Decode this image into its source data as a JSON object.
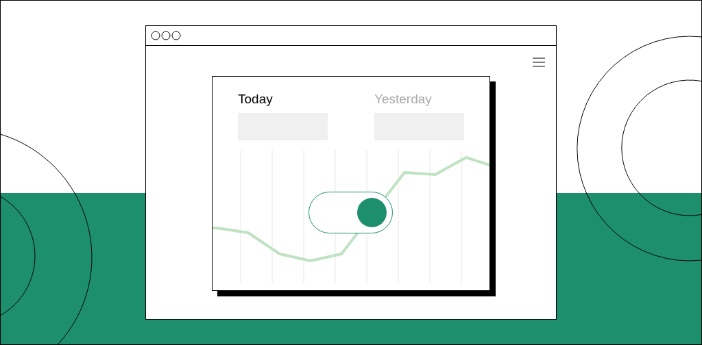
{
  "tabs": [
    {
      "label": "Today",
      "selected": true
    },
    {
      "label": "Yesterday",
      "selected": false
    }
  ],
  "toggle": {
    "on": true
  }
}
